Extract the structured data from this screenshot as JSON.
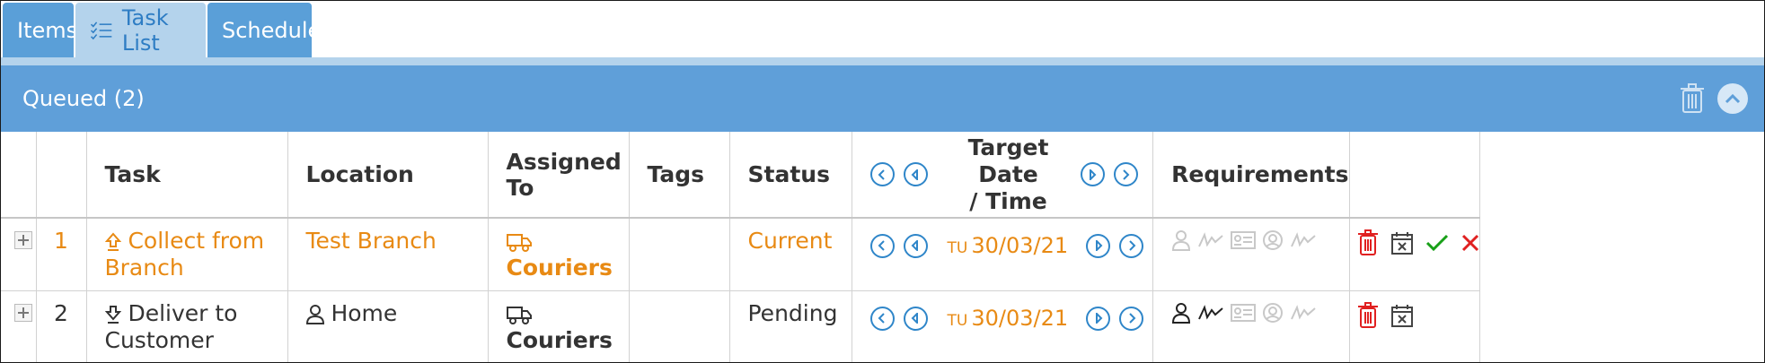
{
  "tabs": [
    {
      "label": "Items",
      "icon": "none"
    },
    {
      "label": "Task List",
      "icon": "checklist-icon",
      "active": true
    },
    {
      "label": "Schedule",
      "icon": "none"
    }
  ],
  "panel": {
    "title": "Queued (2)"
  },
  "columns": {
    "task": "Task",
    "location": "Location",
    "assigned": "Assigned To",
    "tags": "Tags",
    "status": "Status",
    "target_line1": "Target Date",
    "target_line2": "/ Time",
    "requirements": "Requirements"
  },
  "rows": [
    {
      "num": "1",
      "task_line1": "Collect from",
      "task_line2": "Branch",
      "task_icon": "upload-arrow-icon",
      "location": "Test Branch",
      "assigned": "Couriers",
      "tags": "",
      "status": "Current",
      "date_day": "TU",
      "date": "30/03/21",
      "color": "#e88a14"
    },
    {
      "num": "2",
      "task_line1": "Deliver to",
      "task_line2": "Customer",
      "task_icon": "download-arrow-icon",
      "location": "Home",
      "assigned": "Couriers",
      "tags": "",
      "status": "Pending",
      "date_day": "TU",
      "date": "30/03/21",
      "color": "#333333"
    }
  ],
  "colors": {
    "accent": "#5f9fd9",
    "orange": "#e88a14",
    "delete": "#e02020",
    "confirm": "#18a018",
    "blue_icon": "#2f86c9"
  }
}
